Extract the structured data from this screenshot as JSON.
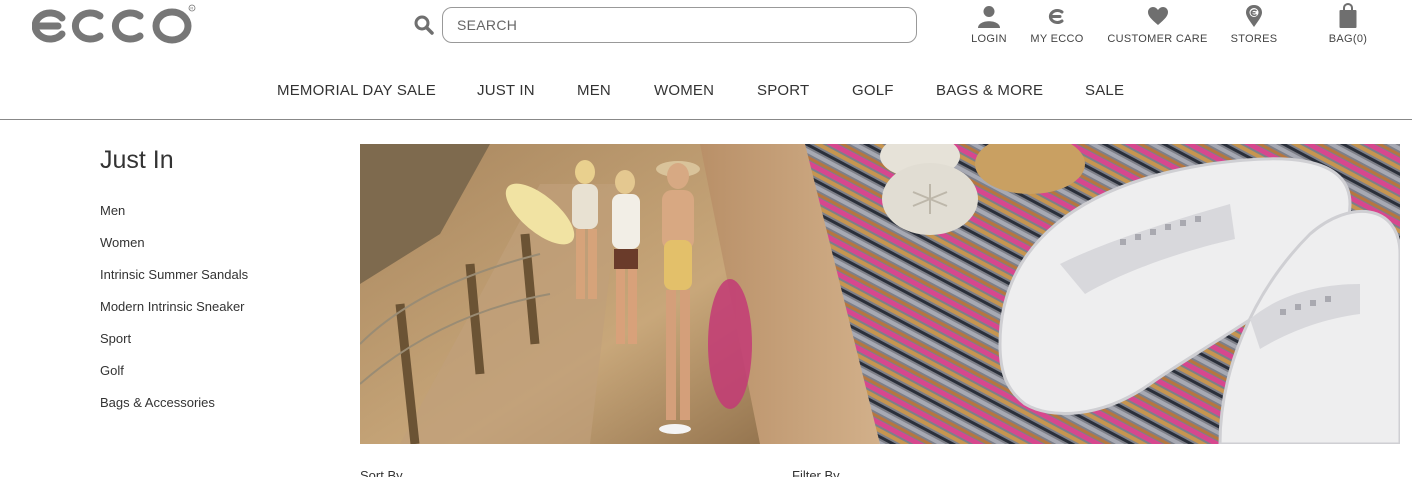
{
  "brand": {
    "logo_text": "ecco"
  },
  "search": {
    "placeholder": "SEARCH"
  },
  "utility_nav": [
    {
      "label": "LOGIN",
      "icon": "user-icon"
    },
    {
      "label": "MY ECCO",
      "icon": "ecco-e-icon"
    },
    {
      "label": "CUSTOMER CARE",
      "icon": "heart-icon"
    },
    {
      "label": "STORES",
      "icon": "map-pin-icon"
    },
    {
      "label": "BAG(0)",
      "icon": "shopping-bag-icon"
    }
  ],
  "main_nav": [
    "MEMORIAL DAY SALE",
    "JUST IN",
    "MEN",
    "WOMEN",
    "SPORT",
    "GOLF",
    "BAGS & MORE",
    "SALE"
  ],
  "sidebar": {
    "title": "Just In",
    "items": [
      "Men",
      "Women",
      "Intrinsic Summer Sandals",
      "Modern Intrinsic Sneaker",
      "Sport",
      "Golf",
      "Bags & Accessories"
    ]
  },
  "hero": {
    "image": "beach-walkers-and-white-flip-flop-sandals"
  },
  "listing_controls": {
    "sort_label": "Sort By",
    "filter_label": "Filter By"
  },
  "colors": {
    "text": "#333333",
    "divider": "#888888",
    "icon": "#6f6f6f"
  }
}
